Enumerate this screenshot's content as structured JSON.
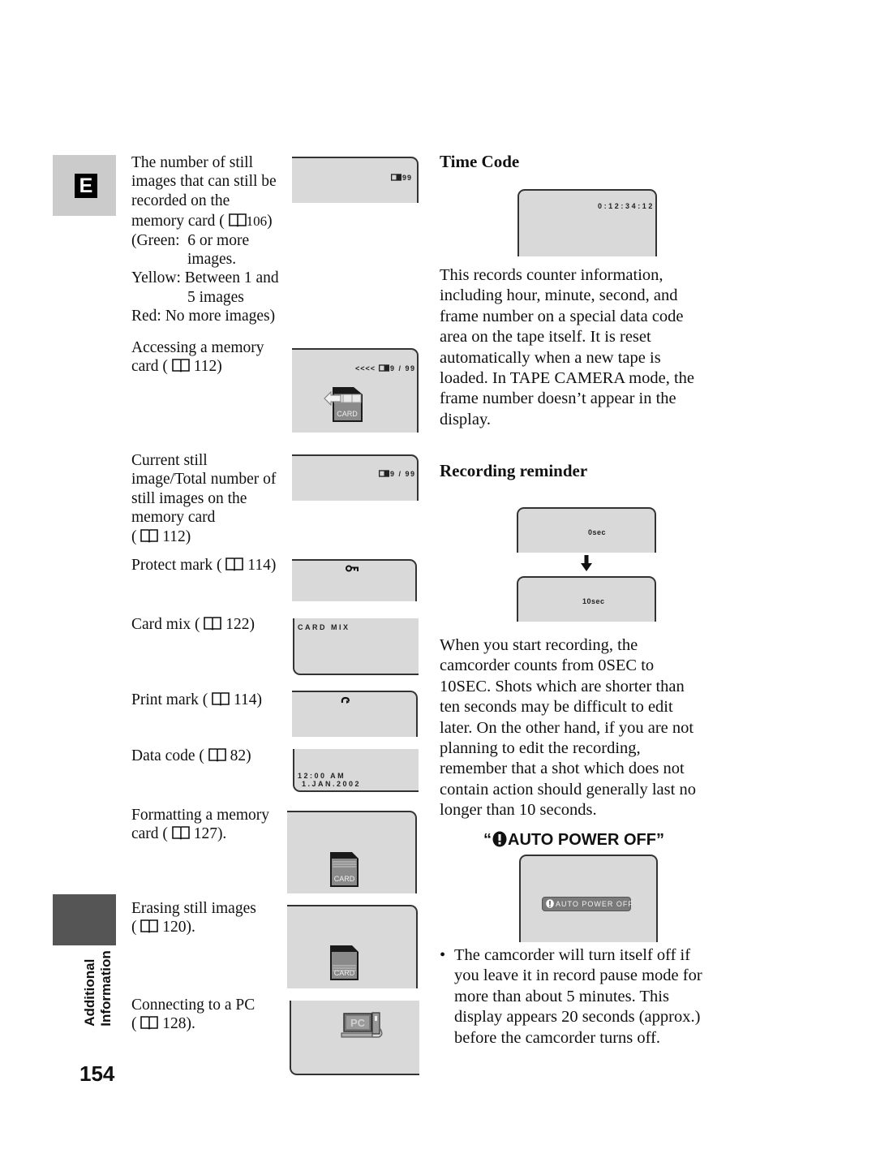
{
  "page": {
    "language_tab": "E",
    "section_tab": [
      "Additional",
      "Information"
    ],
    "page_number": "154"
  },
  "left_items": [
    {
      "id": "still-remaining",
      "lines": [
        "The number of still",
        "images that can still be",
        "recorded on the"
      ],
      "ref_prefix": "memory card (",
      "ref_page": "106",
      "ref_suffix": ")",
      "extra_lines": [
        "(Green:  6 or more",
        "images.",
        "Yellow: Between 1 and",
        "5 images",
        "Red: No more images)"
      ],
      "lcd": {
        "text": "99",
        "icon": "card-small-icon"
      }
    },
    {
      "id": "accessing-card",
      "lines": [
        "Accessing a memory"
      ],
      "ref_prefix": "card (",
      "ref_page": "112",
      "ref_suffix": ")",
      "lcd": {
        "text": "<<<<",
        "text2": "9 / 99",
        "icon": "card-small-icon",
        "graphic": "CARD"
      }
    },
    {
      "id": "current-still",
      "lines": [
        "Current still",
        "image/Total number of",
        "still images on the",
        "memory card"
      ],
      "ref_prefix": "(",
      "ref_page": "112",
      "ref_suffix": ")",
      "lcd": {
        "text": "9 / 99",
        "icon": "card-small-icon"
      }
    },
    {
      "id": "protect-mark",
      "lines": [],
      "ref_prefix": "Protect mark (",
      "ref_page": "114",
      "ref_suffix": ")",
      "lcd": {
        "icon": "key-icon"
      }
    },
    {
      "id": "card-mix",
      "lines": [],
      "ref_prefix": "Card mix (",
      "ref_page": "122",
      "ref_suffix": ")",
      "lcd": {
        "text": "CARD MIX"
      }
    },
    {
      "id": "print-mark",
      "lines": [],
      "ref_prefix": "Print mark (",
      "ref_page": "114",
      "ref_suffix": ")",
      "lcd": {
        "icon": "print-mark-icon"
      }
    },
    {
      "id": "data-code",
      "lines": [],
      "ref_prefix": "Data code (",
      "ref_page": "82",
      "ref_suffix": ")",
      "lcd": {
        "text": "12:00 AM",
        "text2": " 1.JAN.2002"
      }
    },
    {
      "id": "formatting",
      "lines": [
        "Formatting a memory"
      ],
      "ref_prefix": "card (",
      "ref_page": "127",
      "ref_suffix": ").",
      "lcd": {
        "graphic": "CARD"
      }
    },
    {
      "id": "erasing",
      "lines": [
        "Erasing still images"
      ],
      "ref_prefix": "(",
      "ref_page": "120",
      "ref_suffix": ").",
      "lcd": {
        "graphic": "CARD"
      }
    },
    {
      "id": "pc",
      "lines": [
        "Connecting to a PC"
      ],
      "ref_prefix": "(",
      "ref_page": "128",
      "ref_suffix": ").",
      "lcd": {
        "graphic": "PC"
      }
    }
  ],
  "time_code": {
    "heading": "Time Code",
    "lcd_text": "0:12:34:12",
    "body": [
      "This records counter information,",
      "including hour, minute, second, and",
      "frame number on a special data code",
      "area on the tape itself. It is reset",
      "automatically when a new tape is",
      "loaded. In TAPE CAMERA mode, the",
      "frame number doesn’t appear in the",
      "display."
    ]
  },
  "recording_reminder": {
    "heading": "Recording reminder",
    "lcd_start": "0sec",
    "lcd_end": "10sec",
    "body": [
      "When you start recording, the",
      "camcorder counts from 0SEC to",
      "10SEC. Shots which are shorter than",
      "ten seconds may be difficult to edit",
      "later. On the other hand, if you are not",
      "planning to edit the recording,",
      "remember that a shot which does not",
      "contain action should generally last no",
      "longer than 10 seconds."
    ]
  },
  "auto_power_off": {
    "heading_open": "“",
    "heading_text": "AUTO POWER OFF",
    "heading_close": "”",
    "lcd_badge": "AUTO POWER OFF",
    "bullet": "•",
    "body": [
      "The camcorder will turn itself off if",
      "you leave it in record pause mode for",
      "more than about 5 minutes. This",
      "display appears 20 seconds (approx.)",
      "before the camcorder turns off."
    ]
  }
}
